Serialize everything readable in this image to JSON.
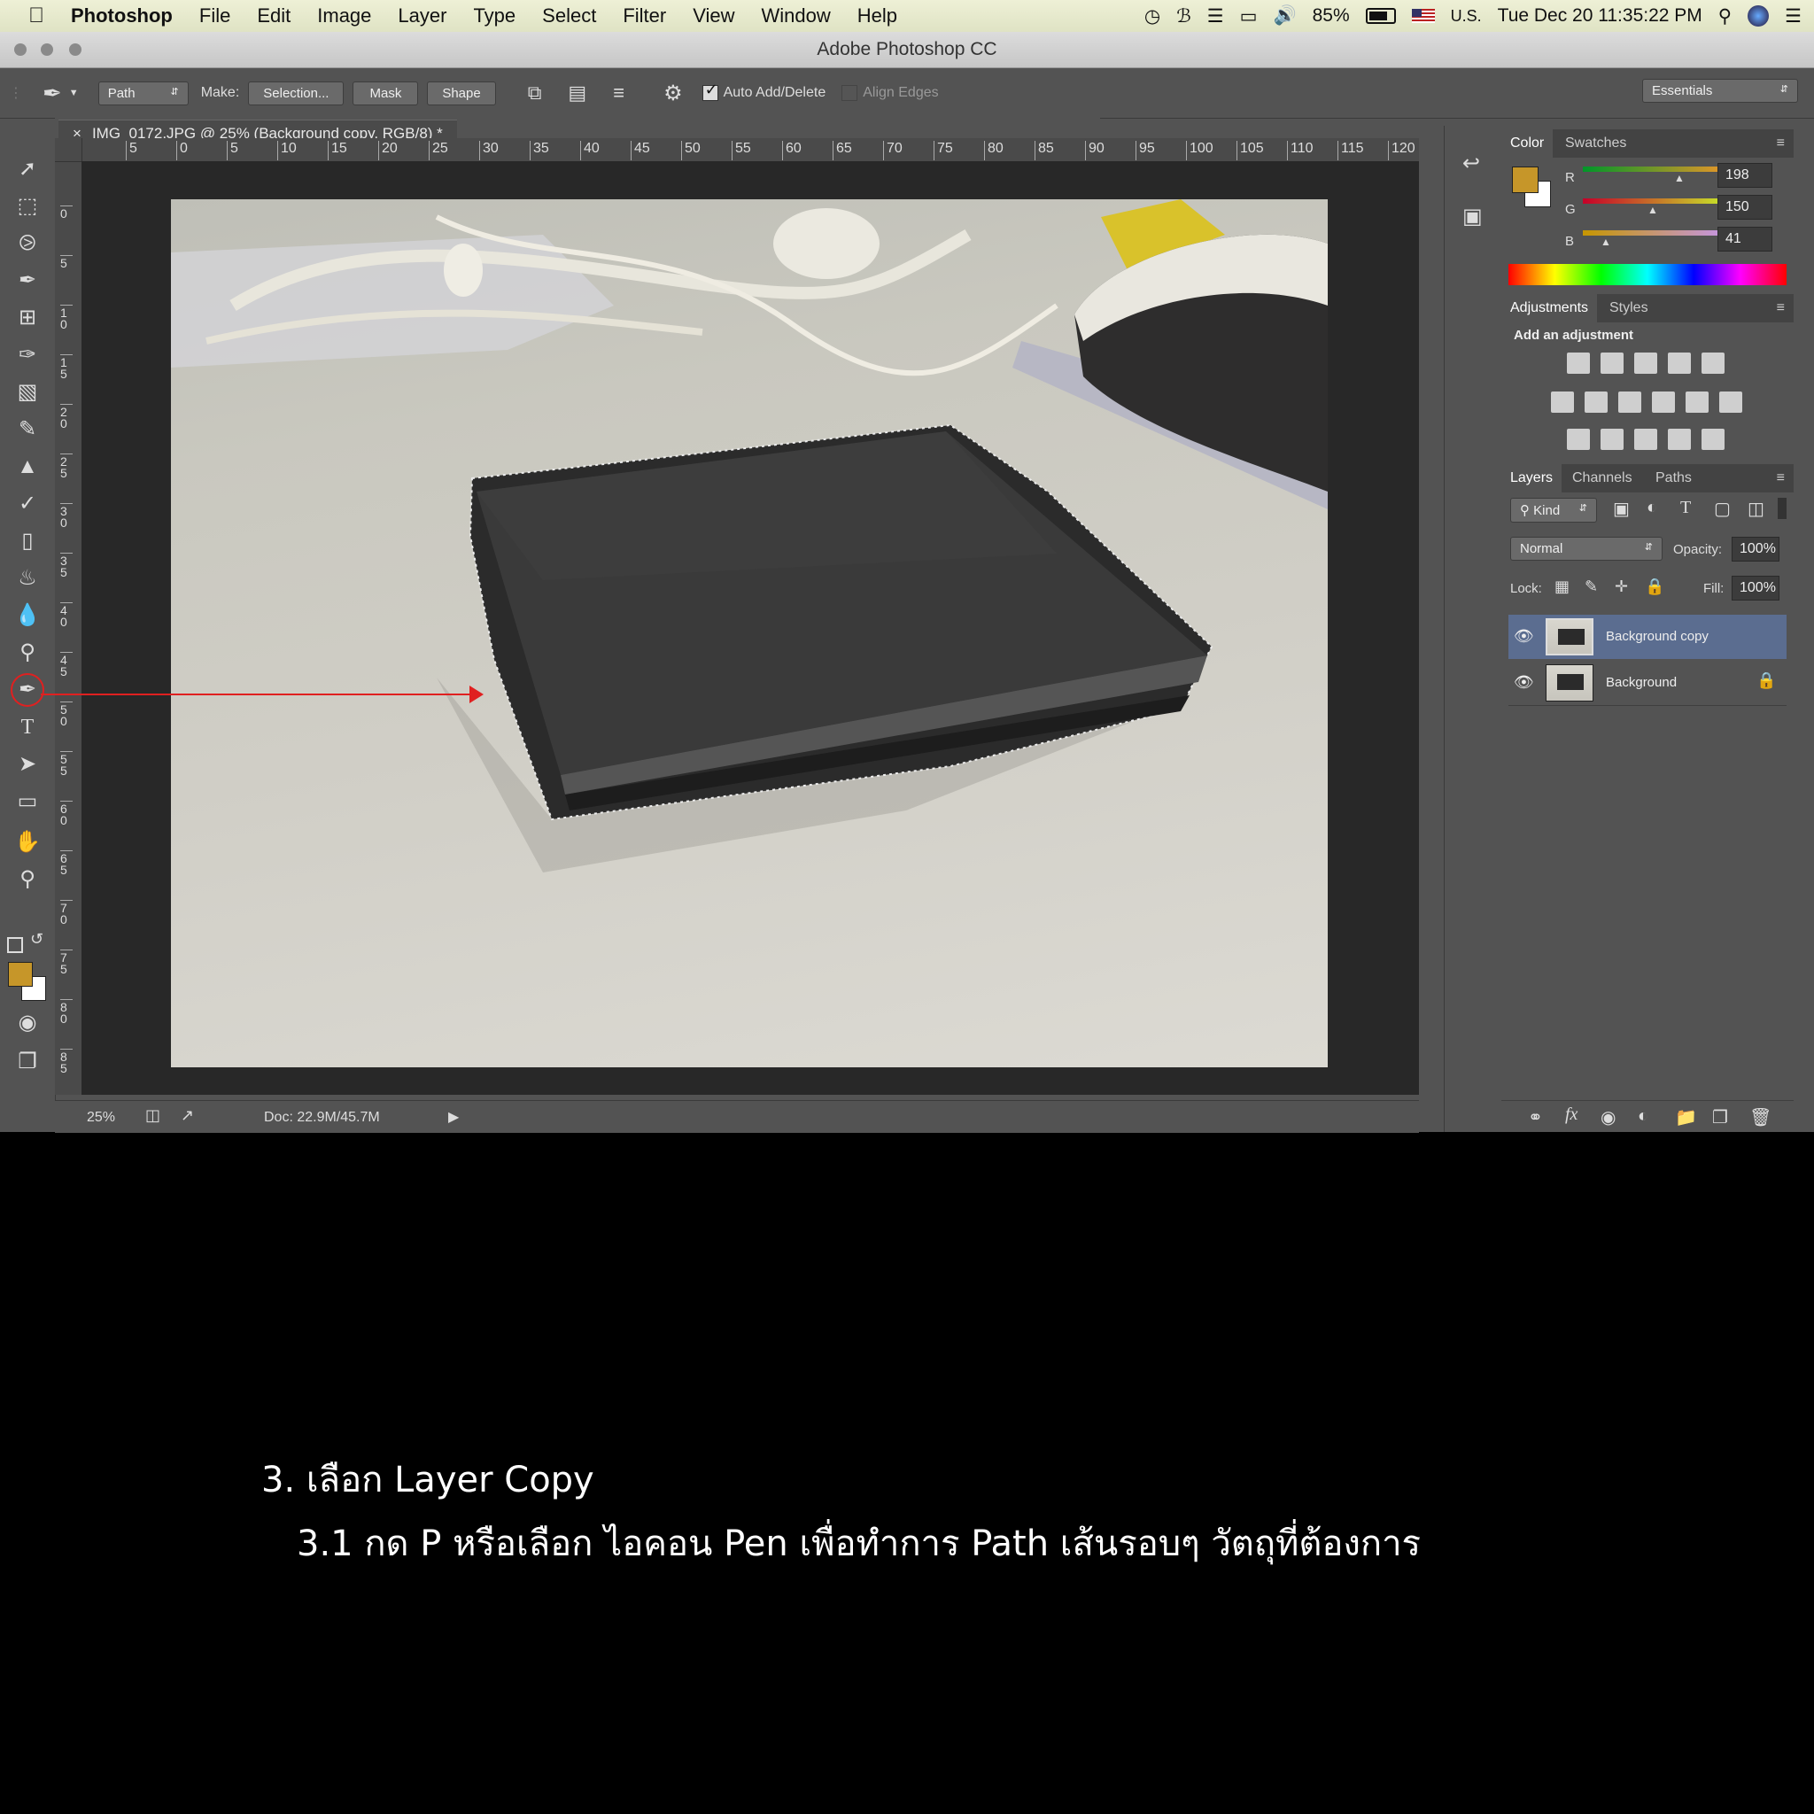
{
  "menubar": {
    "app": "Photoshop",
    "items": [
      "File",
      "Edit",
      "Image",
      "Layer",
      "Type",
      "Select",
      "Filter",
      "View",
      "Window",
      "Help"
    ],
    "battery": "85%",
    "input_source": "U.S.",
    "clock": "Tue Dec 20  11:35:22 PM"
  },
  "window": {
    "title": "Adobe Photoshop CC"
  },
  "options": {
    "mode_select": "Path",
    "make_label": "Make:",
    "selection_btn": "Selection...",
    "mask_btn": "Mask",
    "shape_btn": "Shape",
    "auto_add_delete": "Auto Add/Delete",
    "align_edges": "Align Edges",
    "workspace": "Essentials"
  },
  "document": {
    "tab": "IMG_0172.JPG @ 25% (Background copy, RGB/8) *",
    "ruler_h": [
      "5",
      "0",
      "5",
      "10",
      "15",
      "20",
      "25",
      "30",
      "35",
      "40",
      "45",
      "50",
      "55",
      "60",
      "65",
      "70",
      "75",
      "80",
      "85",
      "90",
      "95",
      "100",
      "105",
      "110",
      "115",
      "120"
    ],
    "ruler_v": [
      "0",
      "5",
      "10",
      "15",
      "20",
      "25",
      "30",
      "35",
      "40",
      "45",
      "50",
      "55",
      "60",
      "65",
      "70",
      "75",
      "80",
      "85"
    ],
    "zoom": "25%",
    "doc_size": "Doc: 22.9M/45.7M"
  },
  "color_panel": {
    "tabs": [
      "Color",
      "Swatches"
    ],
    "r": {
      "label": "R",
      "value": "198"
    },
    "g": {
      "label": "G",
      "value": "150"
    },
    "b": {
      "label": "B",
      "value": "41"
    },
    "foreground": "#c69629"
  },
  "adjustments_panel": {
    "tabs": [
      "Adjustments",
      "Styles"
    ],
    "heading": "Add an adjustment"
  },
  "layers_panel": {
    "tabs": [
      "Layers",
      "Channels",
      "Paths"
    ],
    "filter": "Kind",
    "blend_mode": "Normal",
    "opacity_label": "Opacity:",
    "opacity": "100%",
    "lock_label": "Lock:",
    "fill_label": "Fill:",
    "fill": "100%",
    "layers": [
      {
        "name": "Background copy",
        "selected": true
      },
      {
        "name": "Background",
        "selected": false,
        "locked": true
      }
    ]
  },
  "caption": {
    "line1": "3. เลือก Layer Copy",
    "line2": "3.1 กด P หรือเลือก ไอคอน Pen เพื่อทำการ Path เส้นรอบๆ วัตถุที่ต้องการ"
  }
}
